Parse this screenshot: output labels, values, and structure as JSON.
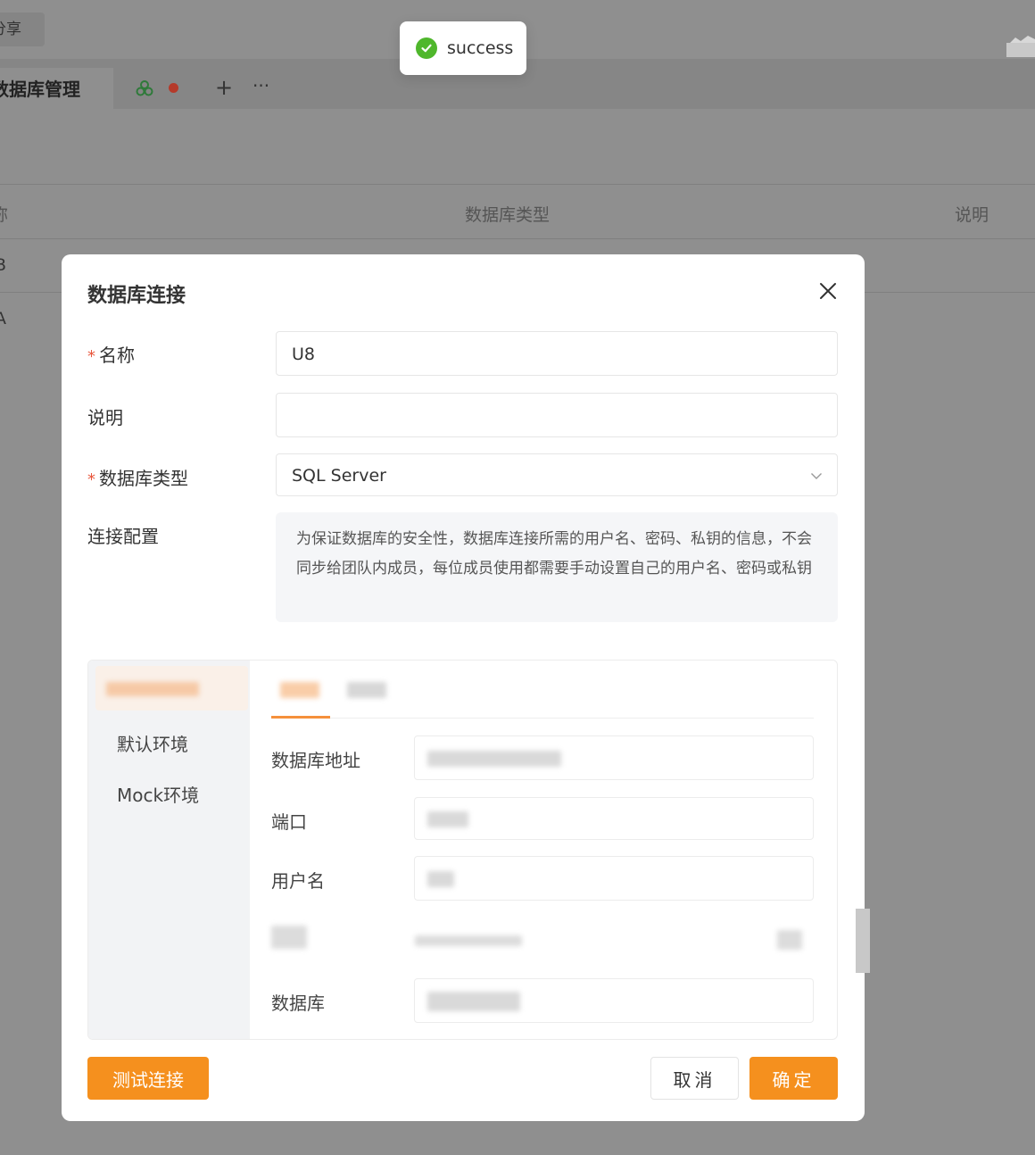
{
  "background": {
    "share_label": "分享",
    "tab_title": "数据库管理",
    "tab_plus": "+",
    "tab_more": "···",
    "table_headers": [
      "称",
      "数据库类型",
      "说明"
    ],
    "table_rows": [
      "B",
      "A"
    ]
  },
  "toast": {
    "text": "success",
    "icon": "check-circle-icon"
  },
  "modal": {
    "title": "数据库连接",
    "fields": {
      "name_label": "名称",
      "name_value": "U8",
      "desc_label": "说明",
      "desc_value": "",
      "db_type_label": "数据库类型",
      "db_type_value": "SQL Server",
      "conn_config_label": "连接配置"
    },
    "notice": "为保证数据库的安全性，数据库连接所需的用户名、密码、私钥的信息，不会同步给团队内成员，每位成员使用都需要手动设置自己的用户名、密码或私钥",
    "env": {
      "items": [
        "默认环境",
        "Mock环境"
      ],
      "field_labels": [
        "数据库地址",
        "端口",
        "用户名",
        "数据库"
      ]
    },
    "buttons": {
      "test": "测试连接",
      "cancel": "取消",
      "ok": "确定"
    }
  },
  "colors": {
    "accent": "#f5901e",
    "required": "#e8563c",
    "success": "#4fb72c"
  }
}
